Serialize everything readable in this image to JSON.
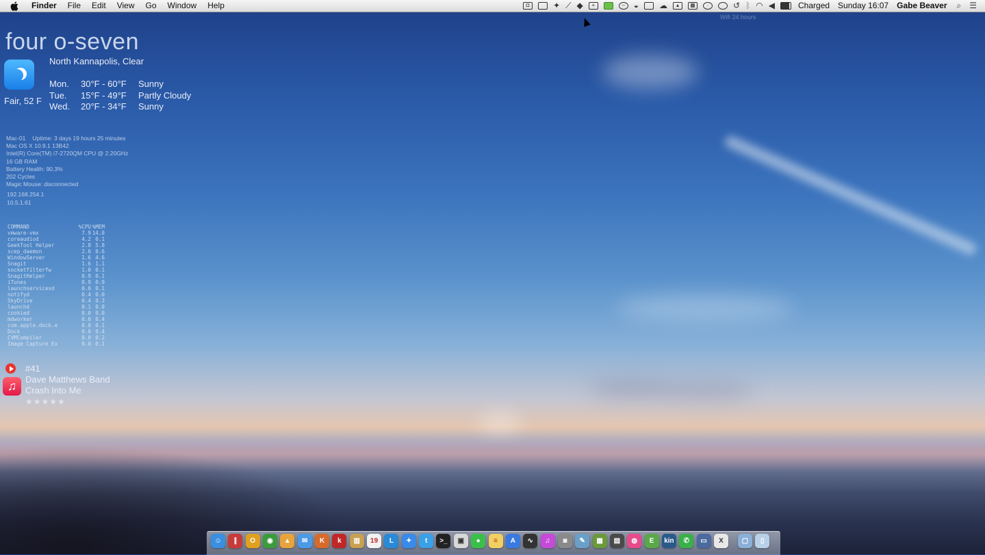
{
  "menubar": {
    "apple_icon": "apple-icon",
    "app_name": "Finder",
    "menus": [
      "File",
      "Edit",
      "View",
      "Go",
      "Window",
      "Help"
    ],
    "status_icons": [
      "camera-icon",
      "screen-icon",
      "twitter-icon",
      "feather-icon",
      "dropbox-icon",
      "shield-icon",
      "evernote-icon",
      "circle-icon",
      "helmet-icon",
      "copy-icon",
      "cloud-icon",
      "airplay-icon",
      "keyboard-icon",
      "clock-icon",
      "chat-icon",
      "timemachine-icon",
      "bluetooth-icon",
      "wifi-icon",
      "volume-icon",
      "battery-icon"
    ],
    "battery_text": "Charged",
    "clock": "Sunday 16:07",
    "user": "Gabe Beaver",
    "spotlight_icon": "spotlight-icon",
    "notifications_icon": "notification-center-icon"
  },
  "wifi_note": "Wifi 24 hours",
  "clock_widget": {
    "text": "four o-seven"
  },
  "weather": {
    "location": "North Kannapolis, Clear",
    "current": "Fair, 52 F",
    "icon": "moon-icon",
    "forecast": [
      {
        "day": "Mon.",
        "temp": "30°F - 60°F",
        "cond": "Sunny"
      },
      {
        "day": "Tue.",
        "temp": "15°F - 49°F",
        "cond": "Partly Cloudy"
      },
      {
        "day": "Wed.",
        "temp": "20°F - 34°F",
        "cond": "Sunny"
      }
    ]
  },
  "system": {
    "host": "Mac-01",
    "uptime": "Uptime: 3 days 19 hours 25 minutes",
    "os": "Mac OS X 10.9.1 13B42",
    "cpu": "Intel(R) Core(TM) i7-2720QM CPU @ 2.20GHz",
    "ram": "16 GB RAM",
    "battery_health": "Battery Health: 90.3%",
    "cycles": "202 Cycles",
    "mouse": "Magic Mouse: disconnected",
    "ip1": "192.168.254.1",
    "ip2": "10.5.1.61"
  },
  "processes": {
    "headers": [
      "COMMAND",
      "%CPU",
      "%MEM"
    ],
    "rows": [
      [
        "vmware-vmx",
        "7.9",
        "14.0"
      ],
      [
        "coreaudiod",
        "4.2",
        "0.1"
      ],
      [
        "GeekTool Helper",
        "2.8",
        "5.8"
      ],
      [
        "scep_daemon",
        "2.6",
        "0.6"
      ],
      [
        "WindowServer",
        "1.6",
        "4.6"
      ],
      [
        "Snagit",
        "1.6",
        "1.1"
      ],
      [
        "socketfilterfw",
        "1.0",
        "0.1"
      ],
      [
        "SnagitHelper",
        "0.9",
        "0.1"
      ],
      [
        "iTunes",
        "0.9",
        "0.9"
      ],
      [
        "launchservicesd",
        "0.6",
        "0.1"
      ],
      [
        "notifyd",
        "0.4",
        "0.0"
      ],
      [
        "SkyDrive",
        "0.4",
        "0.3"
      ],
      [
        "launchd",
        "0.1",
        "0.0"
      ],
      [
        "cookied",
        "0.0",
        "0.0"
      ],
      [
        "mdworker",
        "0.0",
        "0.4"
      ],
      [
        "com.apple.dock.e",
        "0.0",
        "0.1"
      ],
      [
        "Dock",
        "0.0",
        "0.4"
      ],
      [
        "CVMCompiler",
        "0.0",
        "0.2"
      ],
      [
        "Image Capture Ex",
        "0.0",
        "0.1"
      ]
    ]
  },
  "itunes": {
    "track_no": "#41",
    "artist": "Dave Matthews Band",
    "song": "Crash Into Me",
    "stars": "★★★★★",
    "rating": 5
  },
  "dock": {
    "items": [
      {
        "name": "finder",
        "color": "#3a8fe0",
        "glyph": "☺"
      },
      {
        "name": "parallels",
        "color": "#c83b3b",
        "glyph": "∥"
      },
      {
        "name": "opera",
        "color": "#e0a020",
        "glyph": "O"
      },
      {
        "name": "chrome",
        "color": "#3c9c3c",
        "glyph": "◉"
      },
      {
        "name": "vlc",
        "color": "#e8a33a",
        "glyph": "▲"
      },
      {
        "name": "mail",
        "color": "#4a9ae8",
        "glyph": "✉"
      },
      {
        "name": "kindle-reader",
        "color": "#d86a2a",
        "glyph": "K"
      },
      {
        "name": "k-app",
        "color": "#c02828",
        "glyph": "k"
      },
      {
        "name": "archive",
        "color": "#c8a050",
        "glyph": "▥"
      },
      {
        "name": "calendar",
        "color": "#f2f2f2",
        "glyph": "19"
      },
      {
        "name": "lync",
        "color": "#2a8ad8",
        "glyph": "L"
      },
      {
        "name": "safari",
        "color": "#3a8ae8",
        "glyph": "✦"
      },
      {
        "name": "twitter",
        "color": "#3aa0e8",
        "glyph": "t"
      },
      {
        "name": "terminal",
        "color": "#222222",
        "glyph": ">_"
      },
      {
        "name": "preview",
        "color": "#d8d8d8",
        "glyph": "▣"
      },
      {
        "name": "messages",
        "color": "#3ac04a",
        "glyph": "●"
      },
      {
        "name": "notes",
        "color": "#f0d060",
        "glyph": "≡"
      },
      {
        "name": "app-store",
        "color": "#3a7ae0",
        "glyph": "A"
      },
      {
        "name": "activity-monitor",
        "color": "#333333",
        "glyph": "∿"
      },
      {
        "name": "itunes",
        "color": "#c64ad8",
        "glyph": "♫"
      },
      {
        "name": "image-capture",
        "color": "#8a8a8a",
        "glyph": "◙"
      },
      {
        "name": "skitch",
        "color": "#6aa0c8",
        "glyph": "✎"
      },
      {
        "name": "minecraft",
        "color": "#6a9a3a",
        "glyph": "▦"
      },
      {
        "name": "geektool",
        "color": "#4a4a4a",
        "glyph": "▤"
      },
      {
        "name": "color-picker",
        "color": "#e84a8a",
        "glyph": "◍"
      },
      {
        "name": "evernote",
        "color": "#5aa84a",
        "glyph": "E"
      },
      {
        "name": "kindle",
        "color": "#2a5a8a",
        "glyph": "kin"
      },
      {
        "name": "facetime",
        "color": "#3ab04a",
        "glyph": "✆"
      },
      {
        "name": "vmware",
        "color": "#4a6aa0",
        "glyph": "▭"
      },
      {
        "name": "x-app",
        "color": "#e8e8e8",
        "glyph": "X"
      },
      {
        "name": "applications-folder",
        "color": "#8ab0d8",
        "glyph": "▢"
      },
      {
        "name": "trash",
        "color": "#b8d0e8",
        "glyph": "▯"
      }
    ]
  }
}
